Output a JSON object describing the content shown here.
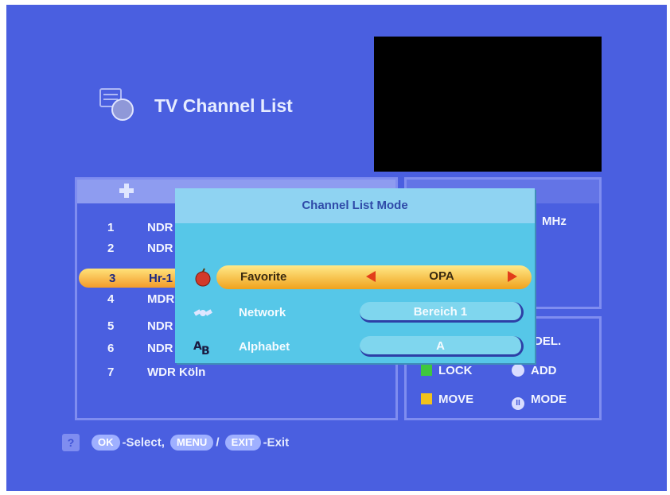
{
  "header": {
    "title": "TV Channel List"
  },
  "channel_list": {
    "rows": [
      {
        "num": "1",
        "name": "NDR"
      },
      {
        "num": "2",
        "name": "NDR"
      },
      {
        "num": "3",
        "name": "Hr-1"
      },
      {
        "num": "4",
        "name": "MDR"
      },
      {
        "num": "5",
        "name": "NDR"
      },
      {
        "num": "6",
        "name": "NDR"
      },
      {
        "num": "7",
        "name": "WDR Köln"
      }
    ],
    "selected_index": 2
  },
  "info": {
    "freq_unit": "MHz"
  },
  "legend": {
    "del": "DEL.",
    "lock": "LOCK",
    "add": "ADD",
    "move": "MOVE",
    "mode": "MODE"
  },
  "modal": {
    "title": "Channel List Mode",
    "options": [
      {
        "label": "Favorite",
        "value": "OPA",
        "icon": "apple-icon"
      },
      {
        "label": "Network",
        "value": "Bereich 1",
        "icon": "satellite-icon"
      },
      {
        "label": "Alphabet",
        "value": "A",
        "icon": "alphabet-icon"
      }
    ]
  },
  "help": {
    "ok": "OK",
    "select_text": "-Select,",
    "menu": "MENU",
    "slash": "/",
    "exit": "EXIT",
    "exit_text": "-Exit"
  },
  "colors": {
    "background": "#4a5fe0",
    "modal": "#56c7e8",
    "highlight": "#f0a21c",
    "legend_lock": "#3fc73f",
    "legend_move": "#f2c21c"
  }
}
